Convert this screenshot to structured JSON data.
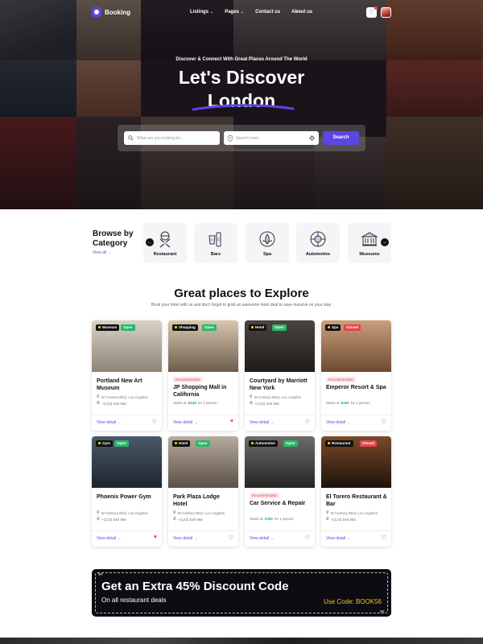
{
  "header": {
    "brand": "Booking",
    "nav": [
      {
        "label": "Listings",
        "caret": "⌄"
      },
      {
        "label": "Pages",
        "caret": "⌄"
      },
      {
        "label": "Contact us",
        "caret": ""
      },
      {
        "label": "About us",
        "caret": ""
      }
    ],
    "more": "···",
    "fav_icon": "♡"
  },
  "hero": {
    "subtitle": "Discover & Connect With Great Places Around The World",
    "title_line1": "Let's Discover",
    "title_line2": "London",
    "search_what_placeholder": "What are you looking for...",
    "search_where_placeholder": "Search hotel",
    "search_button": "Search"
  },
  "categories": {
    "title": "Browse by Category",
    "view_all": "View all →",
    "items": [
      {
        "label": "Restaurant",
        "icon": "restaurant-icon"
      },
      {
        "label": "Bars",
        "icon": "bars-icon"
      },
      {
        "label": "Spa",
        "icon": "spa-icon"
      },
      {
        "label": "Automotive",
        "icon": "automotive-icon"
      },
      {
        "label": "Museums",
        "icon": "museums-icon"
      }
    ]
  },
  "explore": {
    "title": "Great places to Explore",
    "subtitle": "Book your hotel with us and don't forget to grab an awesome hotel deal to save massive on your stay.",
    "view_detail": "View detail →",
    "recommended": "Recommended",
    "address": "W Century Blvd, Los Angeles",
    "phone": "+(123) 548 966",
    "cards": [
      {
        "name": "Portland New Art Museum",
        "category": "Museum",
        "status": "Open",
        "recommended": false,
        "price_prefix": "",
        "price": "",
        "price_suffix": "",
        "favorite": false
      },
      {
        "name": "JP Shopping Mall in California",
        "category": "Shopping",
        "status": "Open",
        "recommended": true,
        "price_prefix": "Starts at",
        "price": "$449",
        "price_suffix": "for 1 person",
        "favorite": true
      },
      {
        "name": "Courtyard by Marriott New York",
        "category": "Hotel",
        "status": "Open",
        "recommended": false,
        "price_prefix": "",
        "price": "",
        "price_suffix": "",
        "favorite": false
      },
      {
        "name": "Emperor Resort & Spa",
        "category": "Spa",
        "status": "Closed",
        "recommended": true,
        "price_prefix": "Starts at",
        "price": "$350",
        "price_suffix": "for 1 person",
        "favorite": false
      },
      {
        "name": "Phoenix Power Gym",
        "category": "Gym",
        "status": "Open",
        "recommended": false,
        "price_prefix": "",
        "price": "",
        "price_suffix": "",
        "favorite": true
      },
      {
        "name": "Park Plaza Lodge Hotel",
        "category": "Hotel",
        "status": "Open",
        "recommended": false,
        "price_prefix": "",
        "price": "",
        "price_suffix": "",
        "favorite": false
      },
      {
        "name": "Car Service & Repair",
        "category": "Automotive",
        "status": "Open",
        "recommended": true,
        "price_prefix": "Starts at",
        "price": "$399",
        "price_suffix": "for 1 person",
        "favorite": false
      },
      {
        "name": "El Torero Restaurant & Bar",
        "category": "Restaurant",
        "status": "Closed",
        "recommended": false,
        "price_prefix": "",
        "price": "",
        "price_suffix": "",
        "favorite": false
      }
    ]
  },
  "promo": {
    "title": "Get an Extra 45% Discount Code",
    "subtitle": "On all restaurant deals",
    "code": "Use Code: BOOK56"
  },
  "colors": {
    "accent": "#5b46e6",
    "open": "#26b86a",
    "closed": "#e8434f",
    "promo_code": "#f5c518"
  }
}
